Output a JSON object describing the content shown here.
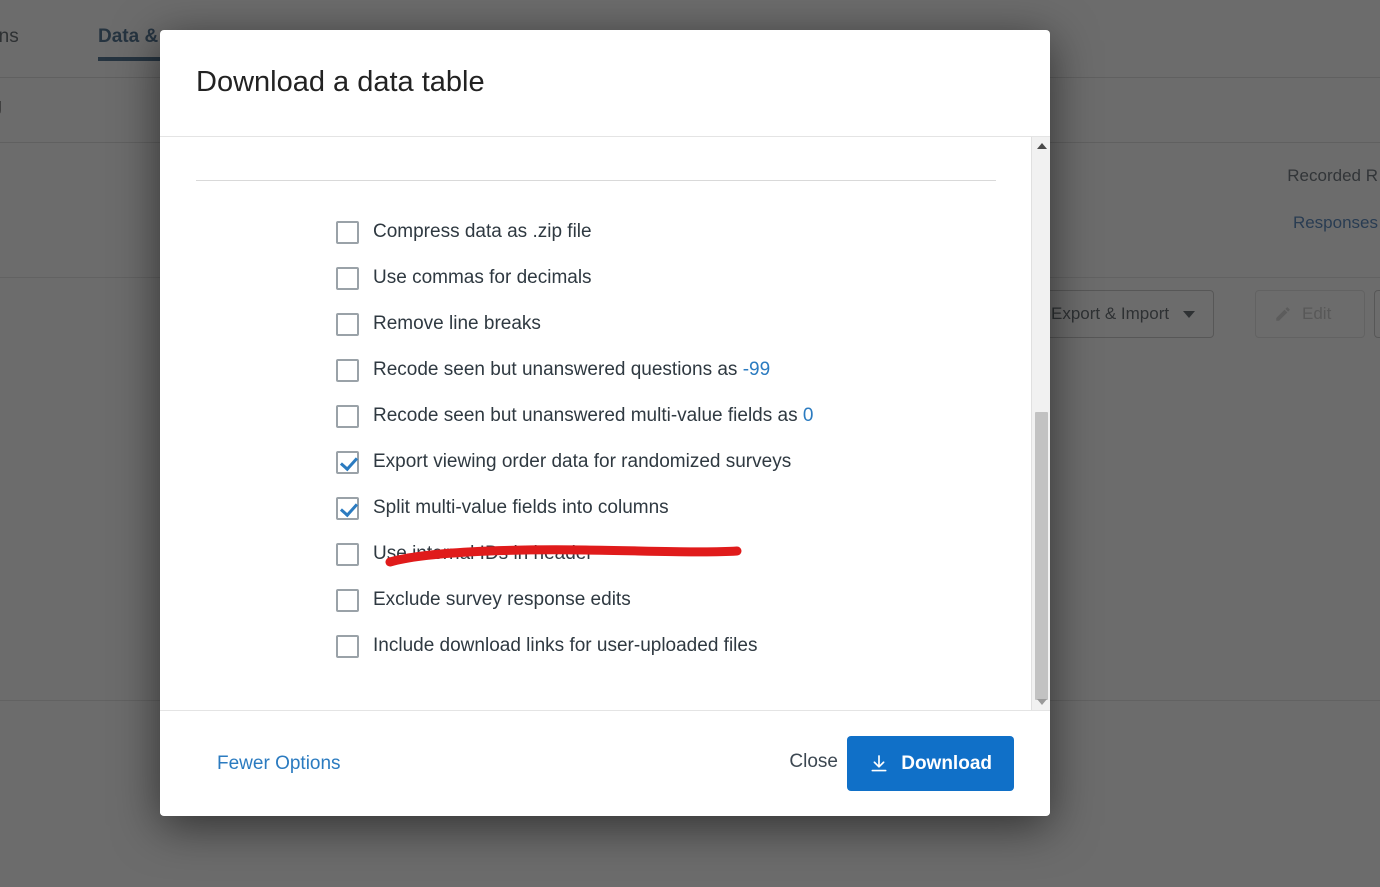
{
  "background": {
    "tabs": [
      {
        "label": "utions",
        "active": false
      },
      {
        "label": "Data &",
        "active": true
      }
    ],
    "sub_label": "ng",
    "recorded_label": "Recorded R",
    "responses_link": "Responses",
    "export_import_button": "Export & Import",
    "edit_button": "Edit"
  },
  "modal": {
    "title": "Download a data table",
    "options": [
      {
        "label": "Compress data as .zip file",
        "checked": false,
        "value": ""
      },
      {
        "label": "Use commas for decimals",
        "checked": false,
        "value": ""
      },
      {
        "label": "Remove line breaks",
        "checked": false,
        "value": ""
      },
      {
        "label": "Recode seen but unanswered questions as ",
        "checked": false,
        "value": "-99"
      },
      {
        "label": "Recode seen but unanswered multi-value fields as ",
        "checked": false,
        "value": "0"
      },
      {
        "label": "Export viewing order data for randomized surveys",
        "checked": true,
        "value": ""
      },
      {
        "label": "Split multi-value fields into columns",
        "checked": true,
        "value": ""
      },
      {
        "label": "Use internal IDs in header",
        "checked": false,
        "value": ""
      },
      {
        "label": "Exclude survey response edits",
        "checked": false,
        "value": ""
      },
      {
        "label": "Include download links for user-uploaded files",
        "checked": false,
        "value": ""
      }
    ],
    "footer": {
      "fewer_options": "Fewer Options",
      "close": "Close",
      "download": "Download",
      "download_icon": "download-arrow-icon"
    },
    "scrollbar": {
      "up_icon": "scroll-up-arrow-icon",
      "down_icon": "scroll-down-arrow-icon"
    }
  },
  "annotation": {
    "type": "freehand-underline",
    "color": "#e01b1b",
    "target": "Export viewing order data for randomized surveys"
  }
}
